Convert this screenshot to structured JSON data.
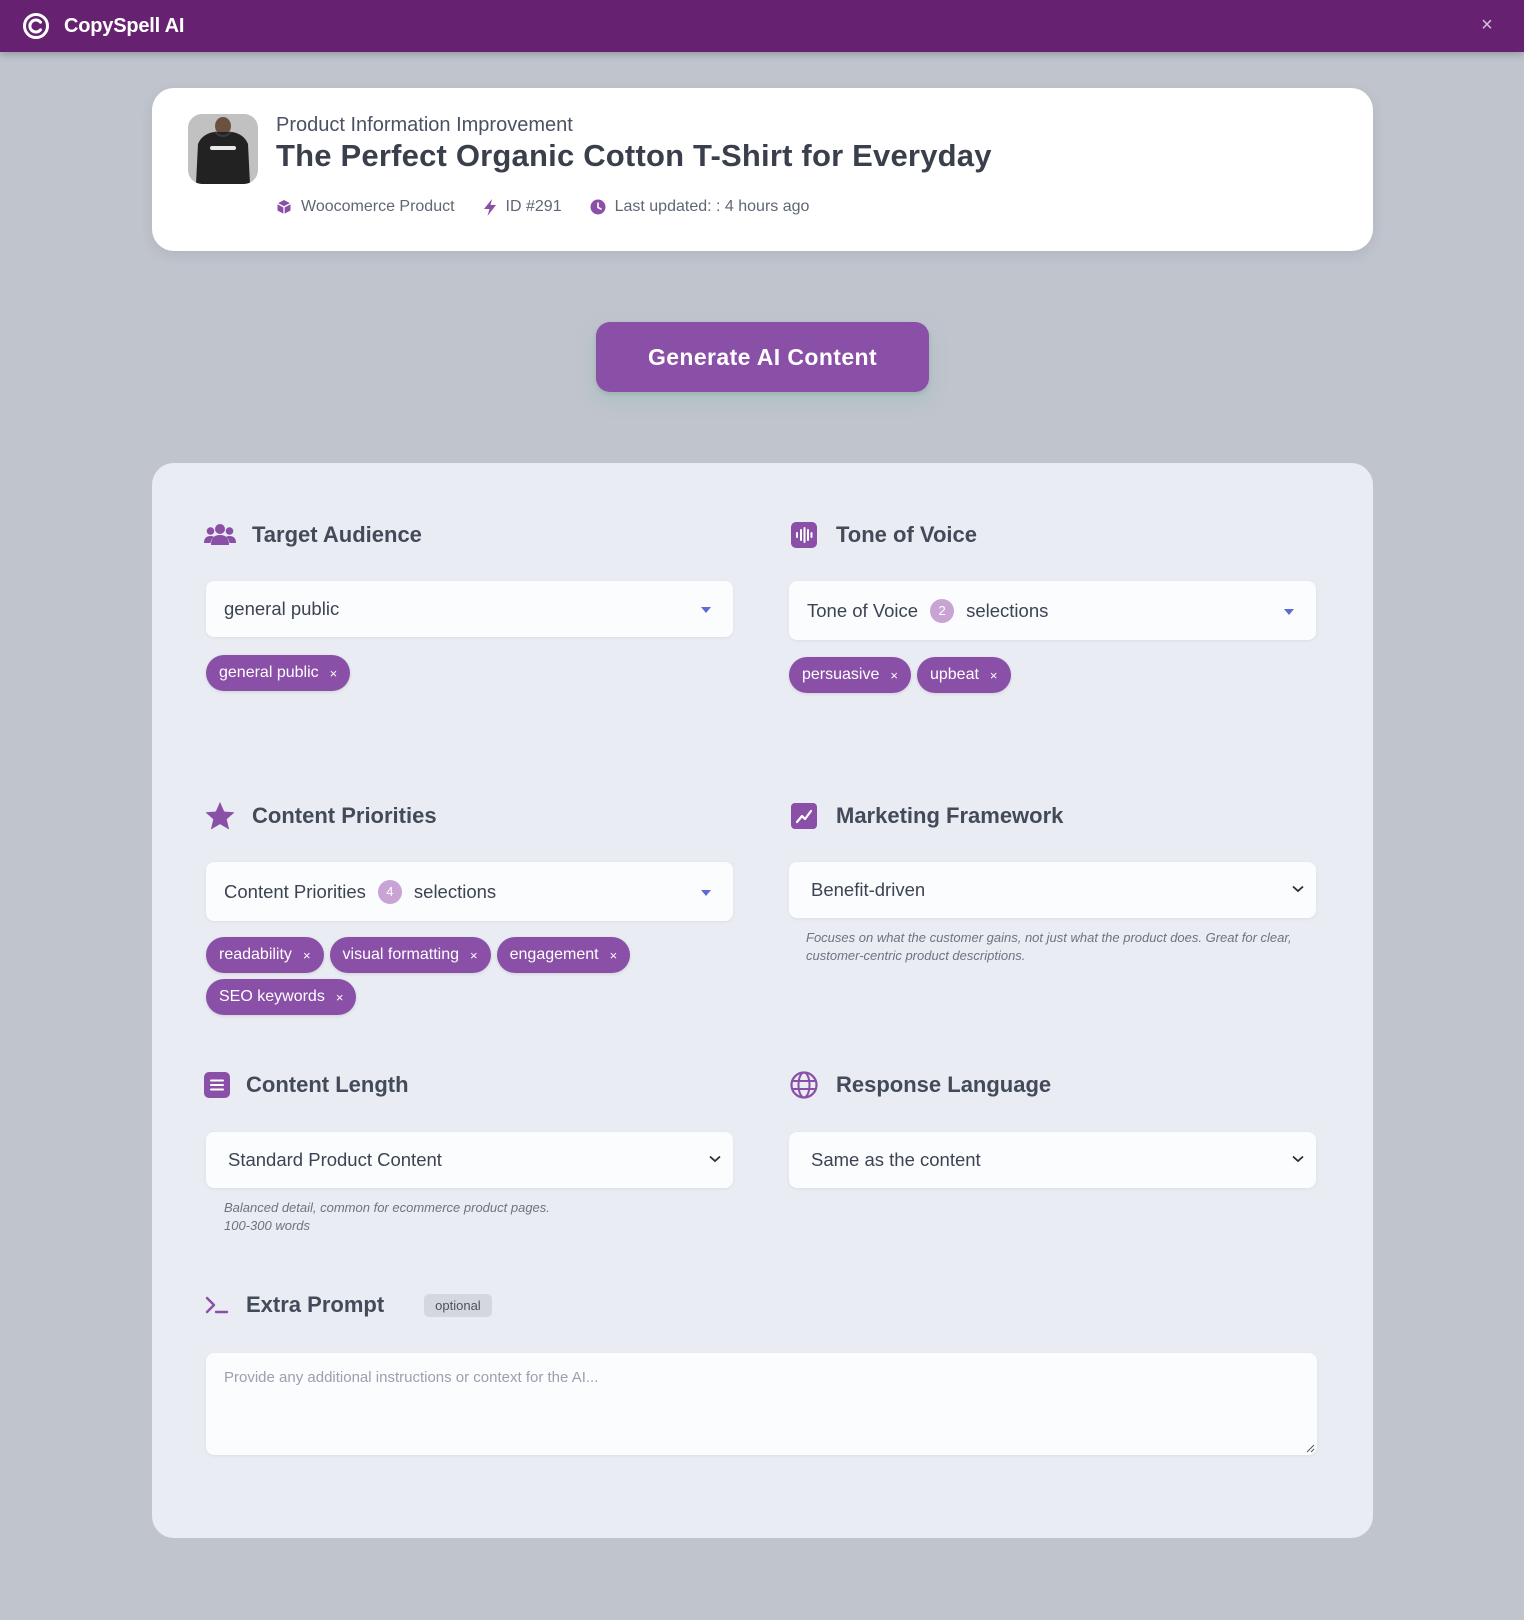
{
  "app": {
    "title": "CopySpell AI",
    "close_icon": "×"
  },
  "header": {
    "subtitle": "Product Information Improvement",
    "title": "The Perfect Organic Cotton T-Shirt for Everyday",
    "meta": {
      "source": "Woocomerce Product",
      "id": "ID #291",
      "updated": "Last updated: : 4 hours ago"
    }
  },
  "generate_button": {
    "label": "Generate AI Content"
  },
  "target_audience": {
    "title": "Target Audience",
    "value": "general public",
    "chips": [
      "general public"
    ]
  },
  "tone_of_voice": {
    "title": "Tone of Voice",
    "field_label": "Tone of Voice",
    "count": "2",
    "count_suffix": "selections",
    "chips": [
      "persuasive",
      "upbeat"
    ]
  },
  "content_priorities": {
    "title": "Content Priorities",
    "field_label": "Content Priorities",
    "count": "4",
    "count_suffix": "selections",
    "chips": [
      "readability",
      "visual formatting",
      "engagement",
      "SEO keywords"
    ]
  },
  "marketing_framework": {
    "title": "Marketing Framework",
    "value": "Benefit-driven",
    "hint": "Focuses on what the customer gains, not just what the product does. Great for clear, customer-centric product descriptions."
  },
  "content_length": {
    "title": "Content Length",
    "value": "Standard Product Content",
    "hint_line1": "Balanced detail, common for ecommerce product pages.",
    "hint_line2": "100-300 words"
  },
  "response_language": {
    "title": "Response Language",
    "value": "Same as the content"
  },
  "extra_prompt": {
    "title": "Extra Prompt",
    "badge": "optional",
    "placeholder": "Provide any additional instructions or context for the AI..."
  },
  "chip_remove_icon": "×",
  "colors": {
    "brand": "#662271",
    "accent": "#8a4fa6",
    "background": "#c0c4cd",
    "panel": "#e9ecf2"
  }
}
